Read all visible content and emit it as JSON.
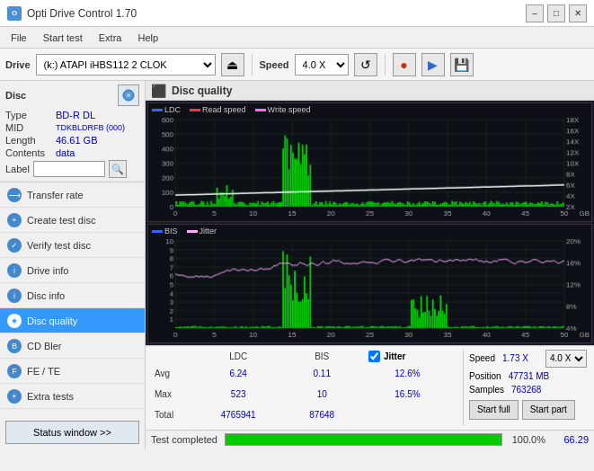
{
  "titlebar": {
    "title": "Opti Drive Control 1.70",
    "icon_label": "ODC",
    "minimize_label": "–",
    "maximize_label": "□",
    "close_label": "✕"
  },
  "menu": {
    "items": [
      "File",
      "Start test",
      "Extra",
      "Help"
    ]
  },
  "toolbar": {
    "drive_label": "Drive",
    "drive_value": "(k:) ATAPI iHBS112  2 CLOK",
    "speed_label": "Speed",
    "speed_value": "4.0 X"
  },
  "disc": {
    "section_label": "Disc",
    "type_label": "Type",
    "type_value": "BD-R DL",
    "mid_label": "MID",
    "mid_value": "TDKBLDRFB (000)",
    "length_label": "Length",
    "length_value": "46.61 GB",
    "contents_label": "Contents",
    "contents_value": "data",
    "label_label": "Label",
    "label_value": ""
  },
  "nav": {
    "items": [
      {
        "label": "Transfer rate",
        "active": false
      },
      {
        "label": "Create test disc",
        "active": false
      },
      {
        "label": "Verify test disc",
        "active": false
      },
      {
        "label": "Drive info",
        "active": false
      },
      {
        "label": "Disc info",
        "active": false
      },
      {
        "label": "Disc quality",
        "active": true
      },
      {
        "label": "CD Bler",
        "active": false
      },
      {
        "label": "FE / TE",
        "active": false
      },
      {
        "label": "Extra tests",
        "active": false
      }
    ],
    "status_btn": "Status window >>"
  },
  "content": {
    "title": "Disc quality",
    "legend_top": {
      "ldc": "LDC",
      "read": "Read speed",
      "write": "Write speed"
    },
    "legend_bottom": {
      "bis": "BIS",
      "jitter": "Jitter"
    }
  },
  "stats": {
    "cols": [
      "LDC",
      "BIS"
    ],
    "jitter_label": "Jitter",
    "jitter_checked": true,
    "rows": [
      {
        "label": "Avg",
        "ldc": "6.24",
        "bis": "0.11",
        "jitter": "12.6%"
      },
      {
        "label": "Max",
        "ldc": "523",
        "bis": "10",
        "jitter": "16.5%"
      },
      {
        "label": "Total",
        "ldc": "4765941",
        "bis": "87648",
        "jitter": ""
      }
    ],
    "speed_label": "Speed",
    "speed_value": "1.73 X",
    "speed_select": "4.0 X",
    "position_label": "Position",
    "position_value": "47731 MB",
    "samples_label": "Samples",
    "samples_value": "763268",
    "start_full_label": "Start full",
    "start_part_label": "Start part"
  },
  "progress": {
    "label": "Test completed",
    "percent": "100.0%",
    "percent_num": 100,
    "speed": "66.29"
  },
  "chart_top": {
    "y_max": 600,
    "y_axis": [
      600,
      500,
      400,
      300,
      200,
      100
    ],
    "y_axis_right": [
      18,
      16,
      14,
      12,
      10,
      8,
      6,
      4,
      2
    ],
    "x_axis": [
      0,
      5,
      10,
      15,
      20,
      25,
      30,
      35,
      40,
      45,
      50
    ]
  },
  "chart_bottom": {
    "y_max": 10,
    "y_axis": [
      10,
      9,
      8,
      7,
      6,
      5,
      4,
      3,
      2,
      1
    ],
    "y_axis_right": [
      20,
      16,
      12,
      8,
      4
    ],
    "x_axis": [
      0,
      5,
      10,
      15,
      20,
      25,
      30,
      35,
      40,
      45,
      50
    ]
  }
}
